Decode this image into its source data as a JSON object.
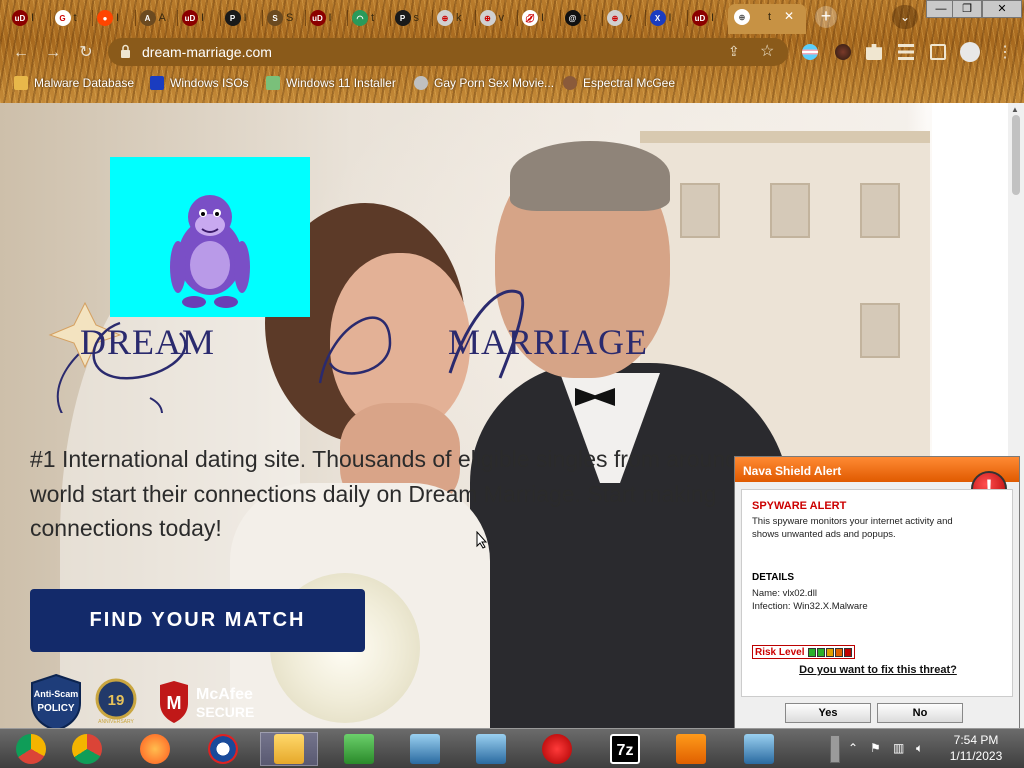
{
  "browser": {
    "url": "dream-marriage.com",
    "active_tab_label": "t",
    "tabs": [
      {
        "icon": "ublock-icon",
        "label": "I"
      },
      {
        "icon": "google-icon",
        "label": "t"
      },
      {
        "icon": "reddit-icon",
        "label": "I"
      },
      {
        "icon": "letter-a-icon",
        "label": "A"
      },
      {
        "icon": "ublock-icon",
        "label": "I"
      },
      {
        "icon": "porn-site-icon",
        "label": "I"
      },
      {
        "icon": "letter-s-icon",
        "label": "S"
      },
      {
        "icon": "ublock-icon",
        "label": "I"
      },
      {
        "icon": "loading-icon",
        "label": "t"
      },
      {
        "icon": "porn-site-icon",
        "label": "s"
      },
      {
        "icon": "globe-icon",
        "label": "k"
      },
      {
        "icon": "globe-icon",
        "label": "v"
      },
      {
        "icon": "lips-icon",
        "label": "I"
      },
      {
        "icon": "threads-icon",
        "label": "t"
      },
      {
        "icon": "globe-icon",
        "label": "v"
      },
      {
        "icon": "x-icon",
        "label": "I"
      },
      {
        "icon": "ublock-icon",
        "label": "I"
      }
    ],
    "new_tab_label": "+",
    "tab_search_label": "⌄",
    "window_controls": {
      "minimize": "—",
      "restore": "❐",
      "close": "✕"
    }
  },
  "bookmarks": [
    {
      "label": "Malware Database",
      "icon": "folder-icon"
    },
    {
      "label": "Windows ISOs",
      "icon": "x-icon"
    },
    {
      "label": "Windows 11 Installer",
      "icon": "image-icon"
    },
    {
      "label": "Gay Porn Sex Movie...",
      "icon": "cd-icon"
    },
    {
      "label": "Espectral McGee",
      "icon": "avatar-icon"
    }
  ],
  "page": {
    "logo_part1": "DREAM",
    "logo_part2": "MARRIAGE",
    "tagline": "#1  International dating site. Thousands of eligible singles from around the world start their connections daily on Dream Marriage. Start making connections today!",
    "cta": "FIND YOUR MATCH",
    "badges": [
      {
        "name": "anti-scam-badge",
        "line1": "Anti-Scam",
        "line2": "POLICY"
      },
      {
        "name": "years-badge",
        "line1": "19",
        "line2": "ANNIVERSARY"
      },
      {
        "name": "mcafee-badge",
        "line1": "McAfee",
        "line2": "SECURE"
      }
    ]
  },
  "popup": {
    "title": "Nava Shield Alert",
    "alert_heading": "SPYWARE ALERT",
    "alert_text_1": "This spyware monitors your internet activity and",
    "alert_text_2": "shows unwanted ads and popups.",
    "details_heading": "DETAILS",
    "detail_name": "Name: vlx02.dll",
    "detail_infection": "Infection: Win32.X.Malware",
    "risk_label": "Risk Level",
    "risk_colors": [
      "#2ab02a",
      "#2ab02a",
      "#e0a000",
      "#e06000",
      "#c00000"
    ],
    "question": "Do you want to fix this threat?",
    "yes_label": "Yes",
    "no_label": "No"
  },
  "taskbar": {
    "apps": [
      "chrome-canary-icon",
      "chrome-icon",
      "firefox-icon",
      "obama-icon",
      "file-explorer-icon",
      "network-icon",
      "installer-icon",
      "installer-icon",
      "angry-birds-icon",
      "7zip-icon",
      "vlc-icon",
      "installer-icon"
    ],
    "sevenzip_label": "7z",
    "time": "7:54 PM",
    "date": "1/11/2023"
  }
}
